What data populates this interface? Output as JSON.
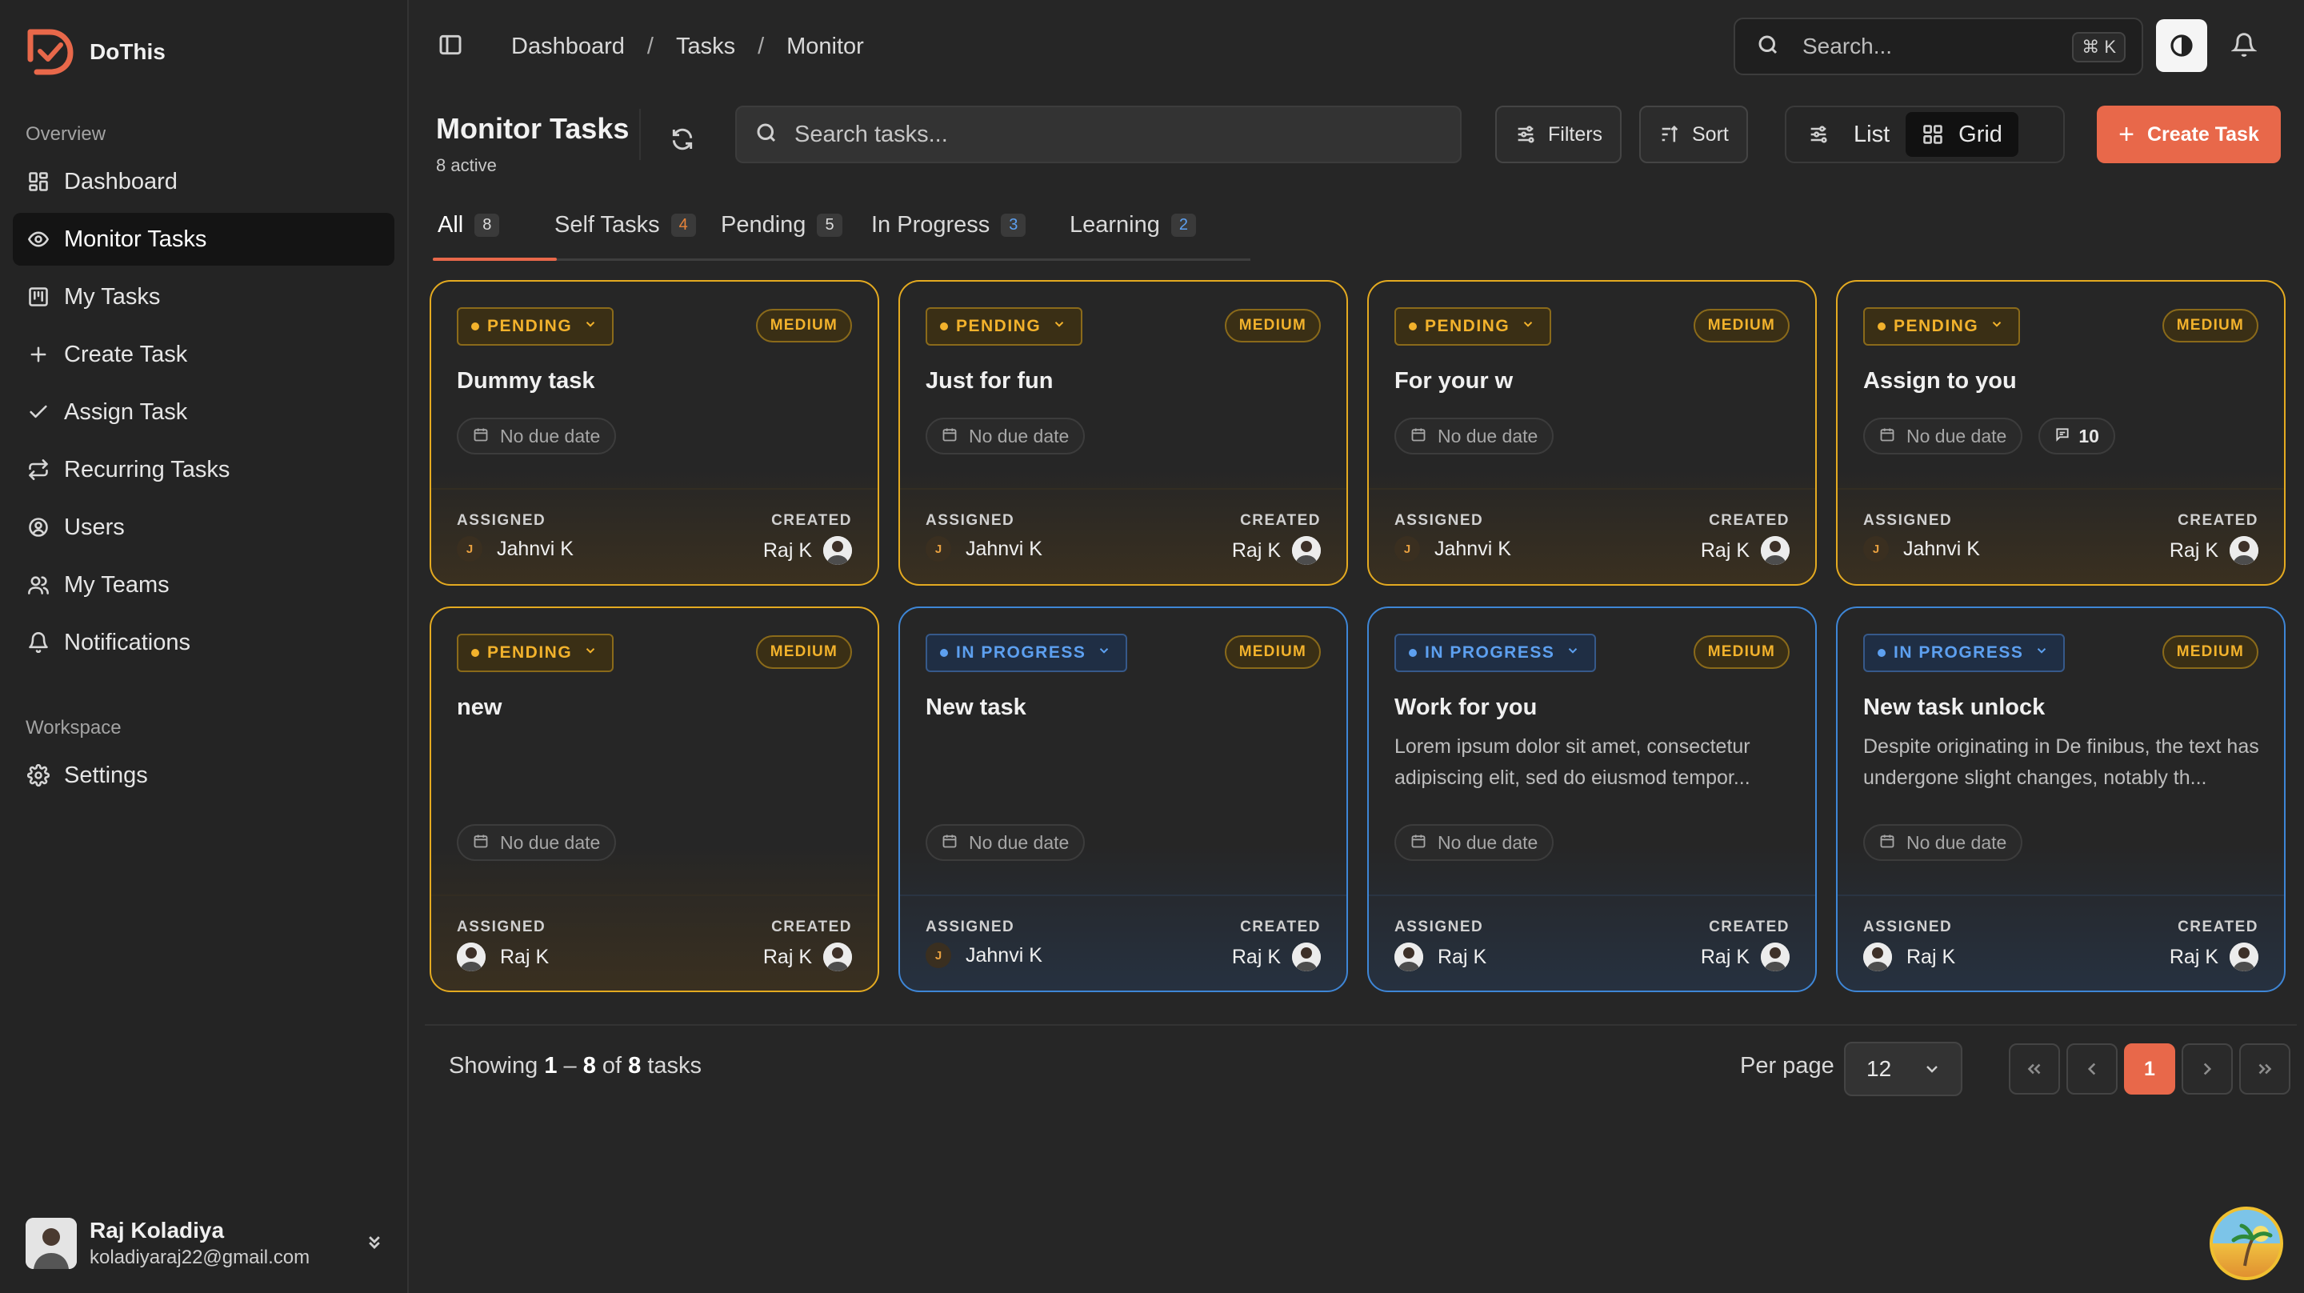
{
  "brand": {
    "name": "DoThis",
    "accent": "#e8684a"
  },
  "sidebar": {
    "overview_label": "Overview",
    "workspace_label": "Workspace",
    "items": [
      {
        "label": "Dashboard",
        "icon": "dashboard-icon"
      },
      {
        "label": "Monitor Tasks",
        "icon": "eye-icon",
        "active": true
      },
      {
        "label": "My Tasks",
        "icon": "kanban-icon"
      },
      {
        "label": "Create Task",
        "icon": "plus-icon"
      },
      {
        "label": "Assign Task",
        "icon": "check-icon"
      },
      {
        "label": "Recurring Tasks",
        "icon": "repeat-icon"
      },
      {
        "label": "Users",
        "icon": "user-circle-icon"
      },
      {
        "label": "My Teams",
        "icon": "users-icon"
      },
      {
        "label": "Notifications",
        "icon": "bell-icon"
      }
    ],
    "workspace_items": [
      {
        "label": "Settings",
        "icon": "gear-icon"
      }
    ],
    "user": {
      "name": "Raj Koladiya",
      "email": "koladiyaraj22@gmail.com"
    }
  },
  "header": {
    "breadcrumbs": [
      "Dashboard",
      "Tasks",
      "Monitor"
    ],
    "search_placeholder": "Search...",
    "shortcut": "⌘ K"
  },
  "toolbar": {
    "title": "Monitor Tasks",
    "subtitle": "8 active",
    "search_placeholder": "Search tasks...",
    "filters_label": "Filters",
    "sort_label": "Sort",
    "list_label": "List",
    "grid_label": "Grid",
    "create_label": "Create Task"
  },
  "tabs": [
    {
      "label": "All",
      "count": "8",
      "active": true
    },
    {
      "label": "Self Tasks",
      "count": "4"
    },
    {
      "label": "Pending",
      "count": "5"
    },
    {
      "label": "In Progress",
      "count": "3"
    },
    {
      "label": "Learning",
      "count": "2"
    }
  ],
  "colors": {
    "pending": "#f2b22c",
    "in_progress": "#5da0f0",
    "medium": "#f2b22c"
  },
  "labels": {
    "assigned": "ASSIGNED",
    "created": "CREATED",
    "no_due": "No due date"
  },
  "cards": [
    {
      "status": "PENDING",
      "priority": "MEDIUM",
      "title": "Dummy task",
      "desc": "",
      "due": "No due date",
      "assigned": "Jahnvi K",
      "assigned_initial": "J",
      "created": "Raj K"
    },
    {
      "status": "PENDING",
      "priority": "MEDIUM",
      "title": "Just for fun",
      "desc": "",
      "due": "No due date",
      "assigned": "Jahnvi K",
      "assigned_initial": "J",
      "created": "Raj K"
    },
    {
      "status": "PENDING",
      "priority": "MEDIUM",
      "title": "For your w",
      "desc": "",
      "due": "No due date",
      "assigned": "Jahnvi K",
      "assigned_initial": "J",
      "created": "Raj K"
    },
    {
      "status": "PENDING",
      "priority": "MEDIUM",
      "title": "Assign to you",
      "desc": "",
      "due": "No due date",
      "comments": "10",
      "assigned": "Jahnvi K",
      "assigned_initial": "J",
      "created": "Raj K"
    },
    {
      "status": "PENDING",
      "priority": "MEDIUM",
      "title": "new",
      "desc": "",
      "due": "No due date",
      "assigned": "Raj K",
      "assigned_initial": "",
      "created": "Raj K"
    },
    {
      "status": "IN PROGRESS",
      "priority": "MEDIUM",
      "title": "New task",
      "desc": "",
      "due": "No due date",
      "assigned": "Jahnvi K",
      "assigned_initial": "J",
      "created": "Raj K"
    },
    {
      "status": "IN PROGRESS",
      "priority": "MEDIUM",
      "title": "Work for you",
      "desc": "Lorem ipsum dolor sit amet, consectetur adipiscing elit, sed do eiusmod tempor...",
      "due": "No due date",
      "assigned": "Raj K",
      "assigned_initial": "",
      "created": "Raj K"
    },
    {
      "status": "IN PROGRESS",
      "priority": "MEDIUM",
      "title": "New task unlock",
      "desc": "Despite originating in De finibus, the text has undergone slight changes, notably th...",
      "due": "No due date",
      "assigned": "Raj K",
      "assigned_initial": "",
      "created": "Raj K"
    }
  ],
  "pagination": {
    "showing_prefix": "Showing",
    "range_start": "1",
    "range_sep": "–",
    "range_end": "8",
    "of": "of",
    "total": "8",
    "suffix": "tasks",
    "per_page_label": "Per page",
    "per_page_value": "12",
    "current_page": "1"
  }
}
